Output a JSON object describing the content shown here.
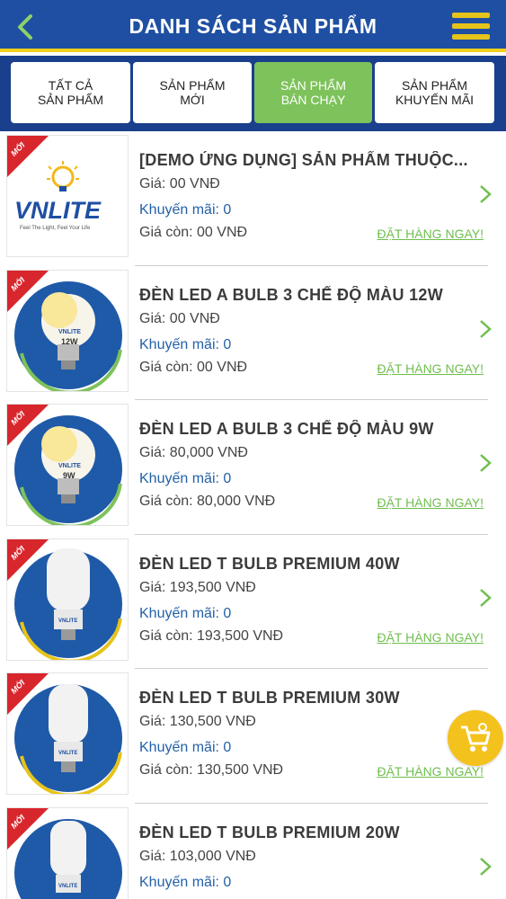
{
  "header": {
    "title": "DANH SÁCH SẢN PHẨM",
    "back_icon": "chevron-left-icon",
    "menu_icon": "hamburger-menu-icon",
    "bg_color": "#1f4fa3",
    "accent_color": "#f2d21b"
  },
  "tabs": [
    {
      "label": "TẤT CẢ\nSẢN PHẨM",
      "active": false
    },
    {
      "label": "SẢN PHẨM\nMỚI",
      "active": false
    },
    {
      "label": "SẢN PHẨM\nBÁN CHẠY",
      "active": true
    },
    {
      "label": "SẢN PHẨM\nKHUYẾN MÃI",
      "active": false
    }
  ],
  "badge_text": "MỚI",
  "logo_text": "VNLITE",
  "logo_tagline": "Feel The Light, Feel Your Life",
  "products": [
    {
      "name": "[DEMO ỨNG DỤNG] SẢN PHẨM THUỘC...",
      "price": "Giá: 00 VNĐ",
      "promo": "Khuyến mãi: 0",
      "remain": "Giá còn: 00 VNĐ",
      "order": "ĐẶT HÀNG NGAY!",
      "image": "vnlite-logo",
      "bulb_label": ""
    },
    {
      "name": "ĐÈN LED A BULB 3 CHẾ ĐỘ MÀU 12W",
      "price": "Giá: 00 VNĐ",
      "promo": "Khuyến mãi: 0",
      "remain": "Giá còn: 00 VNĐ",
      "order": "ĐẶT HÀNG NGAY!",
      "image": "a-bulb",
      "bulb_label": "12W"
    },
    {
      "name": "ĐÈN LED A BULB 3 CHẾ ĐỘ MÀU 9W",
      "price": "Giá: 80,000 VNĐ",
      "promo": "Khuyến mãi: 0",
      "remain": "Giá còn: 80,000 VNĐ",
      "order": "ĐẶT HÀNG NGAY!",
      "image": "a-bulb",
      "bulb_label": "9W"
    },
    {
      "name": "ĐÈN LED T BULB PREMIUM 40W",
      "price": "Giá: 193,500 VNĐ",
      "promo": "Khuyến mãi: 0",
      "remain": "Giá còn: 193,500 VNĐ",
      "order": "ĐẶT HÀNG NGAY!",
      "image": "t-bulb",
      "bulb_label": ""
    },
    {
      "name": "ĐÈN LED T BULB PREMIUM 30W",
      "price": "Giá: 130,500 VNĐ",
      "promo": "Khuyến mãi: 0",
      "remain": "Giá còn: 130,500 VNĐ",
      "order": "ĐẶT HÀNG NGAY!",
      "image": "t-bulb",
      "bulb_label": ""
    },
    {
      "name": "ĐÈN LED T BULB PREMIUM 20W",
      "price": "Giá: 103,000 VNĐ",
      "promo": "Khuyến mãi: 0",
      "remain": "",
      "order": "",
      "image": "t-bulb",
      "bulb_label": ""
    }
  ],
  "cart_icon": "shopping-cart-icon"
}
